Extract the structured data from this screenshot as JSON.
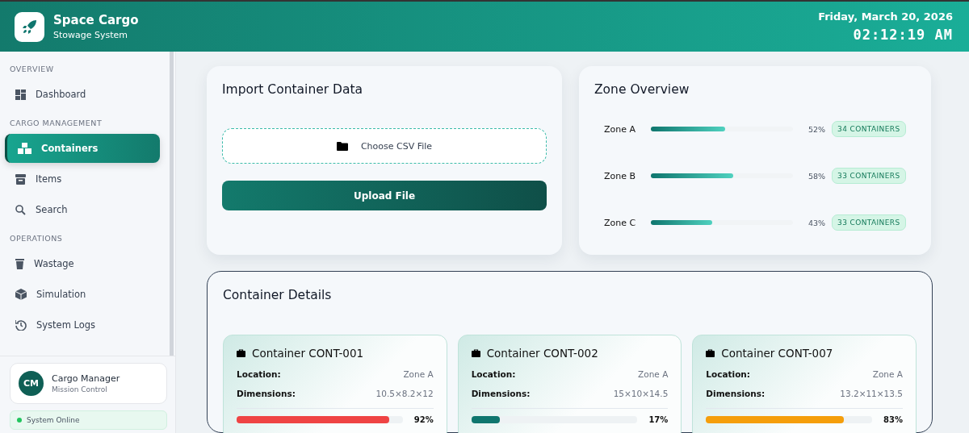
{
  "header": {
    "title": "Space Cargo",
    "subtitle": "Stowage System",
    "date": "Friday, March 20, 2026",
    "time": "02:12:19 AM"
  },
  "sidebar": {
    "sections": [
      {
        "label": "OVERVIEW",
        "items": [
          {
            "label": "Dashboard",
            "selected": false
          }
        ]
      },
      {
        "label": "CARGO MANAGEMENT",
        "items": [
          {
            "label": "Containers",
            "selected": true
          },
          {
            "label": "Items",
            "selected": false
          },
          {
            "label": "Search",
            "selected": false
          }
        ]
      },
      {
        "label": "OPERATIONS",
        "items": [
          {
            "label": "Wastage",
            "selected": false
          },
          {
            "label": "Simulation",
            "selected": false
          },
          {
            "label": "System Logs",
            "selected": false
          }
        ]
      }
    ],
    "user": {
      "initials": "CM",
      "name": "Cargo Manager",
      "role": "Mission Control"
    },
    "status": {
      "label": "System Online",
      "color": "#22c55e"
    }
  },
  "import": {
    "title": "Import Container Data",
    "file_button": "Choose CSV File",
    "upload_button": "Upload File"
  },
  "zones": {
    "title": "Zone Overview",
    "items": [
      {
        "name": "Zone A",
        "level": 0.52,
        "percent": "52%",
        "badge": "34 CONTAINERS"
      },
      {
        "name": "Zone B",
        "level": 0.58,
        "percent": "58%",
        "badge": "33 CONTAINERS"
      },
      {
        "name": "Zone C",
        "level": 0.43,
        "percent": "43%",
        "badge": "33 CONTAINERS"
      }
    ]
  },
  "details": {
    "title": "Container Details",
    "containers": [
      {
        "title": "Container CONT-001",
        "location_label": "Location:",
        "location": "Zone A",
        "dimensions_label": "Dimensions:",
        "dimensions": "10.5×8.2×12",
        "level": 0.92,
        "percent": "92%",
        "color": "#ef4444"
      },
      {
        "title": "Container CONT-002",
        "location_label": "Location:",
        "location": "Zone A",
        "dimensions_label": "Dimensions:",
        "dimensions": "15×10×14.5",
        "level": 0.17,
        "percent": "17%",
        "color": "#0f766e"
      },
      {
        "title": "Container CONT-007",
        "location_label": "Location:",
        "location": "Zone A",
        "dimensions_label": "Dimensions:",
        "dimensions": "13.2×11×13.5",
        "level": 0.83,
        "percent": "83%",
        "color": "#f59e0b"
      }
    ]
  }
}
